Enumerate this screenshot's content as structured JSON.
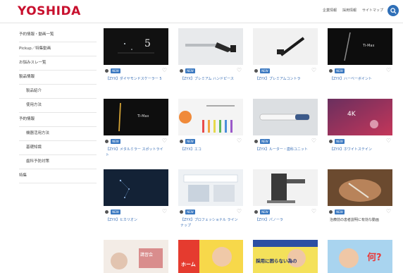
{
  "brand": {
    "logo": "YOSHIDA",
    "color": "#c8102e"
  },
  "header": {
    "links": [
      "企業情報",
      "採用情報",
      "サイトマップ"
    ],
    "search_icon": "search-icon"
  },
  "sidebar": {
    "items": [
      {
        "label": "予約情報・動画一覧",
        "level": "top"
      },
      {
        "label": "Pickup／特集動画",
        "level": "top"
      },
      {
        "label": "お悩みスレ一覧",
        "level": "top"
      },
      {
        "label": "製品情報",
        "level": "section"
      },
      {
        "label": "製品紹介",
        "level": "sub"
      },
      {
        "label": "使用方法",
        "level": "sub"
      },
      {
        "label": "予約情報",
        "level": "section"
      },
      {
        "label": "機器活用方法",
        "level": "sub"
      },
      {
        "label": "基礎知識",
        "level": "sub"
      },
      {
        "label": "歯科予防対策",
        "level": "sub"
      },
      {
        "label": "特集",
        "level": "top"
      }
    ]
  },
  "videos": [
    {
      "badge": "NEW",
      "title": "【ZYX】ダイヤモンドスケーラー 5"
    },
    {
      "badge": "NEW",
      "title": "【ZYX】プレミアム ハンドピース"
    },
    {
      "badge": "NEW",
      "title": "【ZYX】プレミアムコントラ"
    },
    {
      "badge": "NEW",
      "title": "【ZYX】ハーベーボイント"
    },
    {
      "badge": "NEW",
      "title": "【ZYX】メタルミラー スポットライト"
    },
    {
      "badge": "NEW",
      "title": "【ZYX】エコ"
    },
    {
      "badge": "NEW",
      "title": "【ZYX】ルーター・歯科ユニット"
    },
    {
      "badge": "NEW",
      "title": "【ZYX】ホワイトステイン"
    },
    {
      "badge": "NEW",
      "title": "【ZYX】ヒカリオン"
    },
    {
      "badge": "NEW",
      "title": "【ZYX】プロフェッショナル ラインナップ"
    },
    {
      "badge": "NEW",
      "title": "【ZYX】パノーラ"
    },
    {
      "badge": "NEW",
      "title": "治療前の患者説明に有効な動画"
    }
  ],
  "banners": [
    {
      "text": "講習会"
    },
    {
      "text": "ホーム"
    },
    {
      "text": "採用に困らない為の"
    },
    {
      "text": "何?"
    }
  ]
}
